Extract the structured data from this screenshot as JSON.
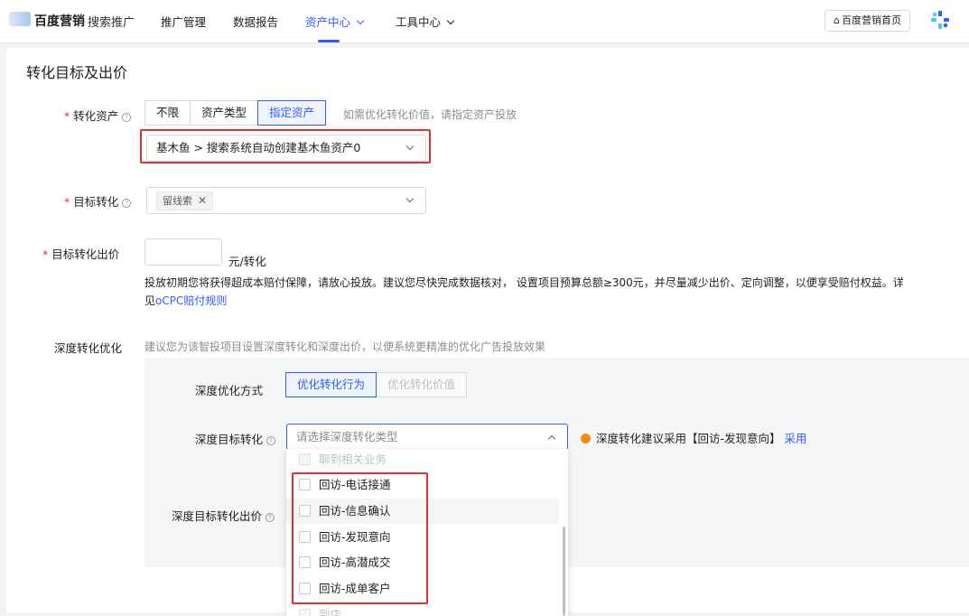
{
  "nav": {
    "brand": "百度营销",
    "brand_sub": "搜索推广",
    "items": [
      "推广管理",
      "数据报告",
      "资产中心",
      "工具中心"
    ],
    "home_button": "百度营销首页"
  },
  "section_title": "转化目标及出价",
  "conversion_asset": {
    "label": "转化资产",
    "options": [
      "不限",
      "资产类型",
      "指定资产"
    ],
    "selected": "指定资产",
    "hint": "如需优化转化价值，请指定资产投放",
    "select_value": "基木鱼 > 搜索系统自动创建基木鱼资产0"
  },
  "target_conversion": {
    "label": "目标转化",
    "tag": "留线索"
  },
  "target_bid": {
    "label": "目标转化出价",
    "value": "",
    "unit": "元/转化",
    "desc_line1": "投放初期您将获得超成本赔付保障，请放心投放。建议您尽快完成数据核对， 设置项目预算总额≥300元，并尽量减少出价、定向调整，以便享受赔付权益。详",
    "desc_line2_prefix": "见",
    "desc_link": "oCPC赔付规则"
  },
  "deep": {
    "label": "深度转化优化",
    "hint": "建议您为该智投项目设置深度转化和深度出价，以便系统更精准的优化广告投放效果",
    "method_label": "深度优化方式",
    "method_options": [
      "优化转化行为",
      "优化转化价值"
    ],
    "method_selected": "优化转化行为",
    "target_label": "深度目标转化",
    "target_placeholder": "请选择深度转化类型",
    "suggest_text": "深度转化建议采用【回访-发现意向】",
    "suggest_link": "采用",
    "bid_label": "深度目标转化出价"
  },
  "dropdown_options": [
    {
      "label": "聊到相关业务",
      "disabled": true
    },
    {
      "label": "回访-电话接通",
      "disabled": false
    },
    {
      "label": "回访-信息确认",
      "disabled": false
    },
    {
      "label": "回访-发现意向",
      "disabled": false
    },
    {
      "label": "回访-高潜成交",
      "disabled": false
    },
    {
      "label": "回访-成单客户",
      "disabled": false
    },
    {
      "label": "到店",
      "disabled": true
    }
  ],
  "colors": {
    "accent": "#2f5bff",
    "highlight_box": "#e0312b",
    "required": "#f5222d"
  }
}
